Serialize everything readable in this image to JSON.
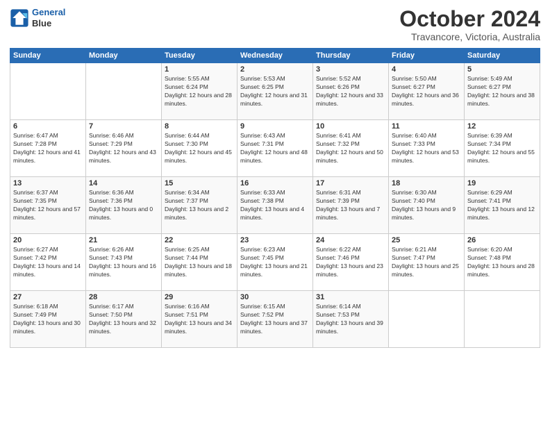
{
  "header": {
    "logo_line1": "General",
    "logo_line2": "Blue",
    "month": "October 2024",
    "location": "Travancore, Victoria, Australia"
  },
  "weekdays": [
    "Sunday",
    "Monday",
    "Tuesday",
    "Wednesday",
    "Thursday",
    "Friday",
    "Saturday"
  ],
  "weeks": [
    [
      {
        "day": "",
        "sunrise": "",
        "sunset": "",
        "daylight": ""
      },
      {
        "day": "",
        "sunrise": "",
        "sunset": "",
        "daylight": ""
      },
      {
        "day": "1",
        "sunrise": "Sunrise: 5:55 AM",
        "sunset": "Sunset: 6:24 PM",
        "daylight": "Daylight: 12 hours and 28 minutes."
      },
      {
        "day": "2",
        "sunrise": "Sunrise: 5:53 AM",
        "sunset": "Sunset: 6:25 PM",
        "daylight": "Daylight: 12 hours and 31 minutes."
      },
      {
        "day": "3",
        "sunrise": "Sunrise: 5:52 AM",
        "sunset": "Sunset: 6:26 PM",
        "daylight": "Daylight: 12 hours and 33 minutes."
      },
      {
        "day": "4",
        "sunrise": "Sunrise: 5:50 AM",
        "sunset": "Sunset: 6:27 PM",
        "daylight": "Daylight: 12 hours and 36 minutes."
      },
      {
        "day": "5",
        "sunrise": "Sunrise: 5:49 AM",
        "sunset": "Sunset: 6:27 PM",
        "daylight": "Daylight: 12 hours and 38 minutes."
      }
    ],
    [
      {
        "day": "6",
        "sunrise": "Sunrise: 6:47 AM",
        "sunset": "Sunset: 7:28 PM",
        "daylight": "Daylight: 12 hours and 41 minutes."
      },
      {
        "day": "7",
        "sunrise": "Sunrise: 6:46 AM",
        "sunset": "Sunset: 7:29 PM",
        "daylight": "Daylight: 12 hours and 43 minutes."
      },
      {
        "day": "8",
        "sunrise": "Sunrise: 6:44 AM",
        "sunset": "Sunset: 7:30 PM",
        "daylight": "Daylight: 12 hours and 45 minutes."
      },
      {
        "day": "9",
        "sunrise": "Sunrise: 6:43 AM",
        "sunset": "Sunset: 7:31 PM",
        "daylight": "Daylight: 12 hours and 48 minutes."
      },
      {
        "day": "10",
        "sunrise": "Sunrise: 6:41 AM",
        "sunset": "Sunset: 7:32 PM",
        "daylight": "Daylight: 12 hours and 50 minutes."
      },
      {
        "day": "11",
        "sunrise": "Sunrise: 6:40 AM",
        "sunset": "Sunset: 7:33 PM",
        "daylight": "Daylight: 12 hours and 53 minutes."
      },
      {
        "day": "12",
        "sunrise": "Sunrise: 6:39 AM",
        "sunset": "Sunset: 7:34 PM",
        "daylight": "Daylight: 12 hours and 55 minutes."
      }
    ],
    [
      {
        "day": "13",
        "sunrise": "Sunrise: 6:37 AM",
        "sunset": "Sunset: 7:35 PM",
        "daylight": "Daylight: 12 hours and 57 minutes."
      },
      {
        "day": "14",
        "sunrise": "Sunrise: 6:36 AM",
        "sunset": "Sunset: 7:36 PM",
        "daylight": "Daylight: 13 hours and 0 minutes."
      },
      {
        "day": "15",
        "sunrise": "Sunrise: 6:34 AM",
        "sunset": "Sunset: 7:37 PM",
        "daylight": "Daylight: 13 hours and 2 minutes."
      },
      {
        "day": "16",
        "sunrise": "Sunrise: 6:33 AM",
        "sunset": "Sunset: 7:38 PM",
        "daylight": "Daylight: 13 hours and 4 minutes."
      },
      {
        "day": "17",
        "sunrise": "Sunrise: 6:31 AM",
        "sunset": "Sunset: 7:39 PM",
        "daylight": "Daylight: 13 hours and 7 minutes."
      },
      {
        "day": "18",
        "sunrise": "Sunrise: 6:30 AM",
        "sunset": "Sunset: 7:40 PM",
        "daylight": "Daylight: 13 hours and 9 minutes."
      },
      {
        "day": "19",
        "sunrise": "Sunrise: 6:29 AM",
        "sunset": "Sunset: 7:41 PM",
        "daylight": "Daylight: 13 hours and 12 minutes."
      }
    ],
    [
      {
        "day": "20",
        "sunrise": "Sunrise: 6:27 AM",
        "sunset": "Sunset: 7:42 PM",
        "daylight": "Daylight: 13 hours and 14 minutes."
      },
      {
        "day": "21",
        "sunrise": "Sunrise: 6:26 AM",
        "sunset": "Sunset: 7:43 PM",
        "daylight": "Daylight: 13 hours and 16 minutes."
      },
      {
        "day": "22",
        "sunrise": "Sunrise: 6:25 AM",
        "sunset": "Sunset: 7:44 PM",
        "daylight": "Daylight: 13 hours and 18 minutes."
      },
      {
        "day": "23",
        "sunrise": "Sunrise: 6:23 AM",
        "sunset": "Sunset: 7:45 PM",
        "daylight": "Daylight: 13 hours and 21 minutes."
      },
      {
        "day": "24",
        "sunrise": "Sunrise: 6:22 AM",
        "sunset": "Sunset: 7:46 PM",
        "daylight": "Daylight: 13 hours and 23 minutes."
      },
      {
        "day": "25",
        "sunrise": "Sunrise: 6:21 AM",
        "sunset": "Sunset: 7:47 PM",
        "daylight": "Daylight: 13 hours and 25 minutes."
      },
      {
        "day": "26",
        "sunrise": "Sunrise: 6:20 AM",
        "sunset": "Sunset: 7:48 PM",
        "daylight": "Daylight: 13 hours and 28 minutes."
      }
    ],
    [
      {
        "day": "27",
        "sunrise": "Sunrise: 6:18 AM",
        "sunset": "Sunset: 7:49 PM",
        "daylight": "Daylight: 13 hours and 30 minutes."
      },
      {
        "day": "28",
        "sunrise": "Sunrise: 6:17 AM",
        "sunset": "Sunset: 7:50 PM",
        "daylight": "Daylight: 13 hours and 32 minutes."
      },
      {
        "day": "29",
        "sunrise": "Sunrise: 6:16 AM",
        "sunset": "Sunset: 7:51 PM",
        "daylight": "Daylight: 13 hours and 34 minutes."
      },
      {
        "day": "30",
        "sunrise": "Sunrise: 6:15 AM",
        "sunset": "Sunset: 7:52 PM",
        "daylight": "Daylight: 13 hours and 37 minutes."
      },
      {
        "day": "31",
        "sunrise": "Sunrise: 6:14 AM",
        "sunset": "Sunset: 7:53 PM",
        "daylight": "Daylight: 13 hours and 39 minutes."
      },
      {
        "day": "",
        "sunrise": "",
        "sunset": "",
        "daylight": ""
      },
      {
        "day": "",
        "sunrise": "",
        "sunset": "",
        "daylight": ""
      }
    ]
  ]
}
